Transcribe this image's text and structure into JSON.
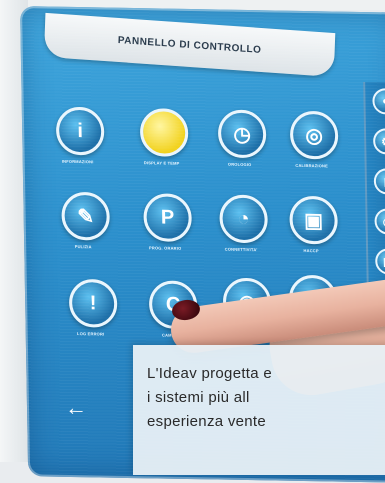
{
  "panel": {
    "title": "PANNELLO DI CONTROLLO"
  },
  "icons": [
    {
      "glyph": "i",
      "label": "INFORMAZIONI",
      "color": "blue"
    },
    {
      "glyph": "",
      "label": "DISPLAY E TEMP",
      "color": "yellow"
    },
    {
      "glyph": "◷",
      "label": "OROLOGIO",
      "color": "blue"
    },
    {
      "glyph": "◎",
      "label": "CALIBRAZIONE",
      "color": "blue"
    },
    {
      "glyph": "✎",
      "label": "PULIZIA",
      "color": "blue"
    },
    {
      "glyph": "P",
      "label": "PROG. ORARIO",
      "color": "blue"
    },
    {
      "glyph": "◔",
      "label": "CONNETTIVITA'",
      "color": "blue"
    },
    {
      "glyph": "▣",
      "label": "HACCP",
      "color": "blue"
    },
    {
      "glyph": "!",
      "label": "LOG ERRORI",
      "color": "blue"
    },
    {
      "glyph": "C",
      "label": "CAMBIO",
      "color": "blue"
    },
    {
      "glyph": "◉",
      "label": "",
      "color": "blue"
    },
    {
      "glyph": "▮",
      "label": "",
      "color": "blue"
    }
  ],
  "side_icons": [
    "●",
    "⚙",
    "▮",
    "◎",
    "▣",
    "⚙"
  ],
  "back_glyph": "←",
  "caption": {
    "line1": "L'Ideav progetta e",
    "line2": "i  sistemi  più  all",
    "line3": "esperienza  vente"
  },
  "colors": {
    "screen": "#2b8fcc",
    "highlight": "#f2d21e",
    "nail": "#5a0f18"
  }
}
